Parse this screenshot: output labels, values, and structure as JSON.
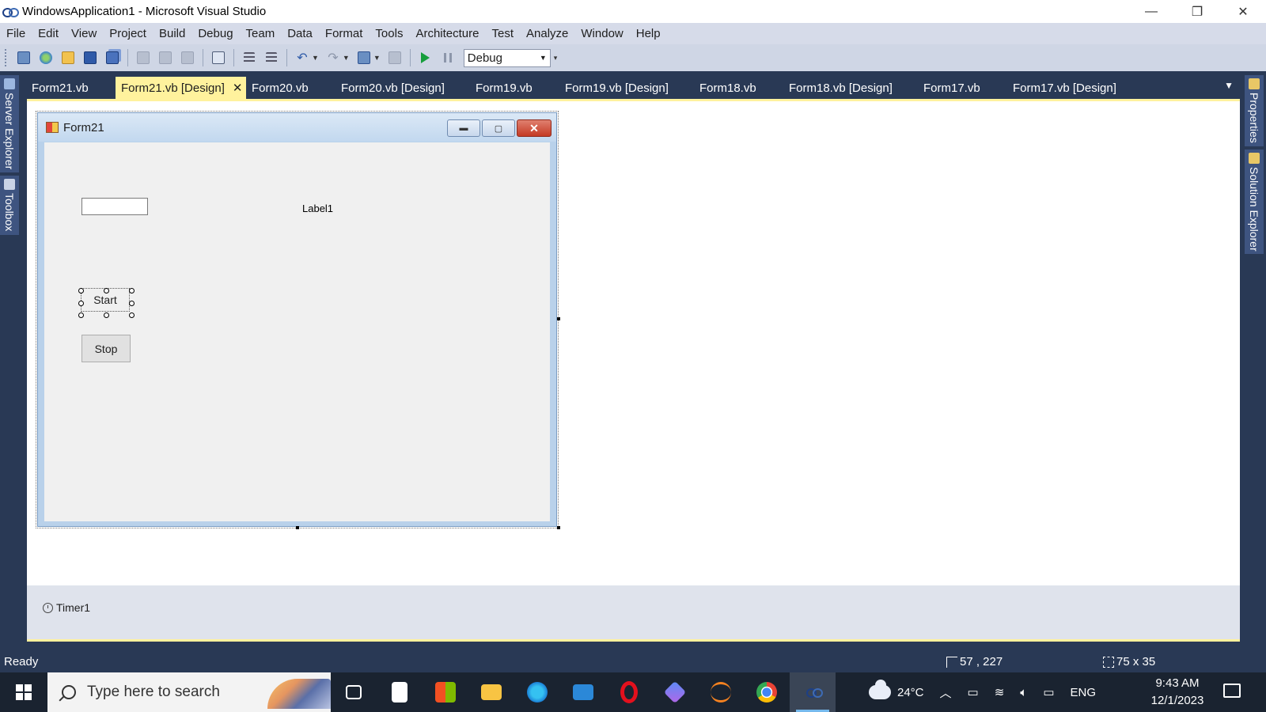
{
  "window": {
    "title": "WindowsApplication1 - Microsoft Visual Studio",
    "minimize": "—",
    "restore": "❐",
    "close": "✕"
  },
  "menu": [
    "File",
    "Edit",
    "View",
    "Project",
    "Build",
    "Debug",
    "Team",
    "Data",
    "Format",
    "Tools",
    "Architecture",
    "Test",
    "Analyze",
    "Window",
    "Help"
  ],
  "toolbar": {
    "configuration": "Debug"
  },
  "tabs": [
    {
      "label": "Form21.vb",
      "active": false
    },
    {
      "label": "Form21.vb [Design]",
      "active": true
    },
    {
      "label": "Form20.vb",
      "active": false
    },
    {
      "label": "Form20.vb [Design]",
      "active": false
    },
    {
      "label": "Form19.vb",
      "active": false
    },
    {
      "label": "Form19.vb [Design]",
      "active": false
    },
    {
      "label": "Form18.vb",
      "active": false
    },
    {
      "label": "Form18.vb [Design]",
      "active": false
    },
    {
      "label": "Form17.vb",
      "active": false
    },
    {
      "label": "Form17.vb [Design]",
      "active": false
    }
  ],
  "tab_close": "✕",
  "left_rail": [
    "Server Explorer",
    "Toolbox"
  ],
  "right_rail": [
    "Properties",
    "Solution Explorer"
  ],
  "form": {
    "title": "Form21",
    "label1": "Label1",
    "start_button": "Start",
    "stop_button": "Stop"
  },
  "tray": {
    "component": "Timer1"
  },
  "status": {
    "text": "Ready",
    "position": "57 , 227",
    "size": "75 x 35"
  },
  "taskbar": {
    "search_placeholder": "Type here to search",
    "weather": "24°C",
    "language": "ENG",
    "time": "9:43 AM",
    "date": "12/1/2023"
  },
  "colors": {
    "ide_background": "#293955",
    "active_tab": "#fff29d",
    "menu_background": "#d6dbe9"
  }
}
